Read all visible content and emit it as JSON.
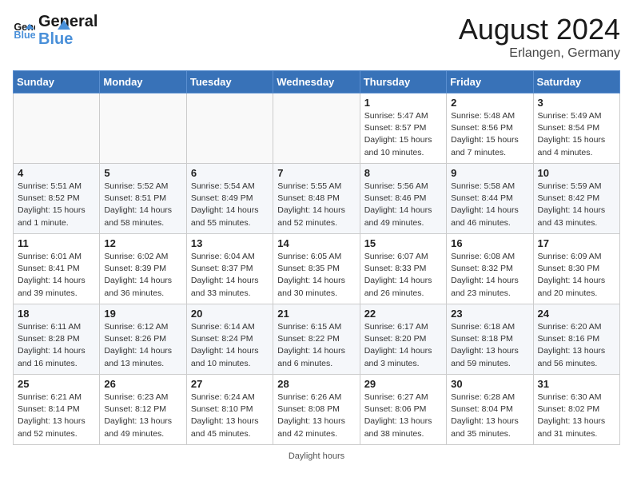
{
  "header": {
    "logo_general": "General",
    "logo_blue": "Blue",
    "month_year": "August 2024",
    "location": "Erlangen, Germany"
  },
  "days_of_week": [
    "Sunday",
    "Monday",
    "Tuesday",
    "Wednesday",
    "Thursday",
    "Friday",
    "Saturday"
  ],
  "weeks": [
    [
      {
        "day": "",
        "info": ""
      },
      {
        "day": "",
        "info": ""
      },
      {
        "day": "",
        "info": ""
      },
      {
        "day": "",
        "info": ""
      },
      {
        "day": "1",
        "info": "Sunrise: 5:47 AM\nSunset: 8:57 PM\nDaylight: 15 hours\nand 10 minutes."
      },
      {
        "day": "2",
        "info": "Sunrise: 5:48 AM\nSunset: 8:56 PM\nDaylight: 15 hours\nand 7 minutes."
      },
      {
        "day": "3",
        "info": "Sunrise: 5:49 AM\nSunset: 8:54 PM\nDaylight: 15 hours\nand 4 minutes."
      }
    ],
    [
      {
        "day": "4",
        "info": "Sunrise: 5:51 AM\nSunset: 8:52 PM\nDaylight: 15 hours\nand 1 minute."
      },
      {
        "day": "5",
        "info": "Sunrise: 5:52 AM\nSunset: 8:51 PM\nDaylight: 14 hours\nand 58 minutes."
      },
      {
        "day": "6",
        "info": "Sunrise: 5:54 AM\nSunset: 8:49 PM\nDaylight: 14 hours\nand 55 minutes."
      },
      {
        "day": "7",
        "info": "Sunrise: 5:55 AM\nSunset: 8:48 PM\nDaylight: 14 hours\nand 52 minutes."
      },
      {
        "day": "8",
        "info": "Sunrise: 5:56 AM\nSunset: 8:46 PM\nDaylight: 14 hours\nand 49 minutes."
      },
      {
        "day": "9",
        "info": "Sunrise: 5:58 AM\nSunset: 8:44 PM\nDaylight: 14 hours\nand 46 minutes."
      },
      {
        "day": "10",
        "info": "Sunrise: 5:59 AM\nSunset: 8:42 PM\nDaylight: 14 hours\nand 43 minutes."
      }
    ],
    [
      {
        "day": "11",
        "info": "Sunrise: 6:01 AM\nSunset: 8:41 PM\nDaylight: 14 hours\nand 39 minutes."
      },
      {
        "day": "12",
        "info": "Sunrise: 6:02 AM\nSunset: 8:39 PM\nDaylight: 14 hours\nand 36 minutes."
      },
      {
        "day": "13",
        "info": "Sunrise: 6:04 AM\nSunset: 8:37 PM\nDaylight: 14 hours\nand 33 minutes."
      },
      {
        "day": "14",
        "info": "Sunrise: 6:05 AM\nSunset: 8:35 PM\nDaylight: 14 hours\nand 30 minutes."
      },
      {
        "day": "15",
        "info": "Sunrise: 6:07 AM\nSunset: 8:33 PM\nDaylight: 14 hours\nand 26 minutes."
      },
      {
        "day": "16",
        "info": "Sunrise: 6:08 AM\nSunset: 8:32 PM\nDaylight: 14 hours\nand 23 minutes."
      },
      {
        "day": "17",
        "info": "Sunrise: 6:09 AM\nSunset: 8:30 PM\nDaylight: 14 hours\nand 20 minutes."
      }
    ],
    [
      {
        "day": "18",
        "info": "Sunrise: 6:11 AM\nSunset: 8:28 PM\nDaylight: 14 hours\nand 16 minutes."
      },
      {
        "day": "19",
        "info": "Sunrise: 6:12 AM\nSunset: 8:26 PM\nDaylight: 14 hours\nand 13 minutes."
      },
      {
        "day": "20",
        "info": "Sunrise: 6:14 AM\nSunset: 8:24 PM\nDaylight: 14 hours\nand 10 minutes."
      },
      {
        "day": "21",
        "info": "Sunrise: 6:15 AM\nSunset: 8:22 PM\nDaylight: 14 hours\nand 6 minutes."
      },
      {
        "day": "22",
        "info": "Sunrise: 6:17 AM\nSunset: 8:20 PM\nDaylight: 14 hours\nand 3 minutes."
      },
      {
        "day": "23",
        "info": "Sunrise: 6:18 AM\nSunset: 8:18 PM\nDaylight: 13 hours\nand 59 minutes."
      },
      {
        "day": "24",
        "info": "Sunrise: 6:20 AM\nSunset: 8:16 PM\nDaylight: 13 hours\nand 56 minutes."
      }
    ],
    [
      {
        "day": "25",
        "info": "Sunrise: 6:21 AM\nSunset: 8:14 PM\nDaylight: 13 hours\nand 52 minutes."
      },
      {
        "day": "26",
        "info": "Sunrise: 6:23 AM\nSunset: 8:12 PM\nDaylight: 13 hours\nand 49 minutes."
      },
      {
        "day": "27",
        "info": "Sunrise: 6:24 AM\nSunset: 8:10 PM\nDaylight: 13 hours\nand 45 minutes."
      },
      {
        "day": "28",
        "info": "Sunrise: 6:26 AM\nSunset: 8:08 PM\nDaylight: 13 hours\nand 42 minutes."
      },
      {
        "day": "29",
        "info": "Sunrise: 6:27 AM\nSunset: 8:06 PM\nDaylight: 13 hours\nand 38 minutes."
      },
      {
        "day": "30",
        "info": "Sunrise: 6:28 AM\nSunset: 8:04 PM\nDaylight: 13 hours\nand 35 minutes."
      },
      {
        "day": "31",
        "info": "Sunrise: 6:30 AM\nSunset: 8:02 PM\nDaylight: 13 hours\nand 31 minutes."
      }
    ]
  ],
  "footer": {
    "note": "Daylight hours"
  }
}
